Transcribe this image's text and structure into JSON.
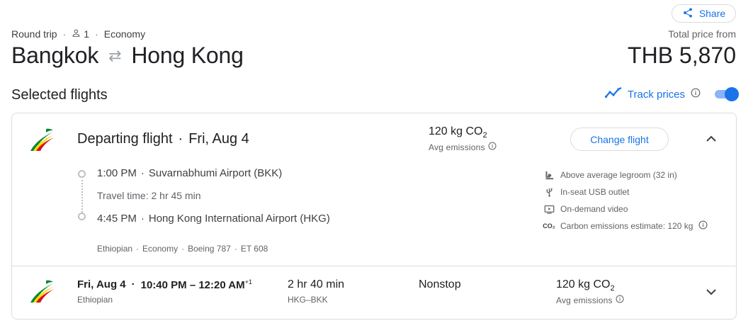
{
  "header": {
    "share_label": "Share",
    "trip_type": "Round trip",
    "passengers": "1",
    "cabin": "Economy",
    "origin": "Bangkok",
    "destination": "Hong Kong",
    "total_label": "Total price from",
    "total_price": "THB 5,870"
  },
  "section": {
    "title": "Selected flights",
    "track_label": "Track prices",
    "track_enabled": true
  },
  "departing": {
    "title": "Departing flight",
    "date": "Fri, Aug 4",
    "emissions": "120 kg CO",
    "emissions_sub": "2",
    "emissions_label": "Avg emissions",
    "change_label": "Change flight",
    "depart_time": "1:00 PM",
    "depart_airport": "Suvarnabhumi Airport (BKK)",
    "travel_time": "Travel time: 2 hr 45 min",
    "arrive_time": "4:45 PM",
    "arrive_airport": "Hong Kong International Airport (HKG)",
    "airline": "Ethiopian",
    "cabin": "Economy",
    "aircraft": "Boeing 787",
    "flight_number": "ET 608",
    "amenities": [
      {
        "icon": "legroom-icon",
        "label": "Above average legroom (32 in)"
      },
      {
        "icon": "usb-icon",
        "label": "In-seat USB outlet"
      },
      {
        "icon": "video-icon",
        "label": "On-demand video"
      },
      {
        "icon": "co2-icon",
        "label": "Carbon emissions estimate: 120 kg"
      }
    ]
  },
  "returning": {
    "date": "Fri, Aug 4",
    "times": "10:40 PM – 12:20 AM",
    "day_offset": "+1",
    "airline": "Ethiopian",
    "duration": "2 hr 40 min",
    "route": "HKG–BKK",
    "stops": "Nonstop",
    "emissions": "120 kg CO",
    "emissions_sub": "2",
    "emissions_label": "Avg emissions"
  },
  "colors": {
    "accent": "#1a73e8",
    "logo_green": "#078930",
    "logo_yellow": "#fcdd09",
    "logo_red": "#da121a"
  }
}
